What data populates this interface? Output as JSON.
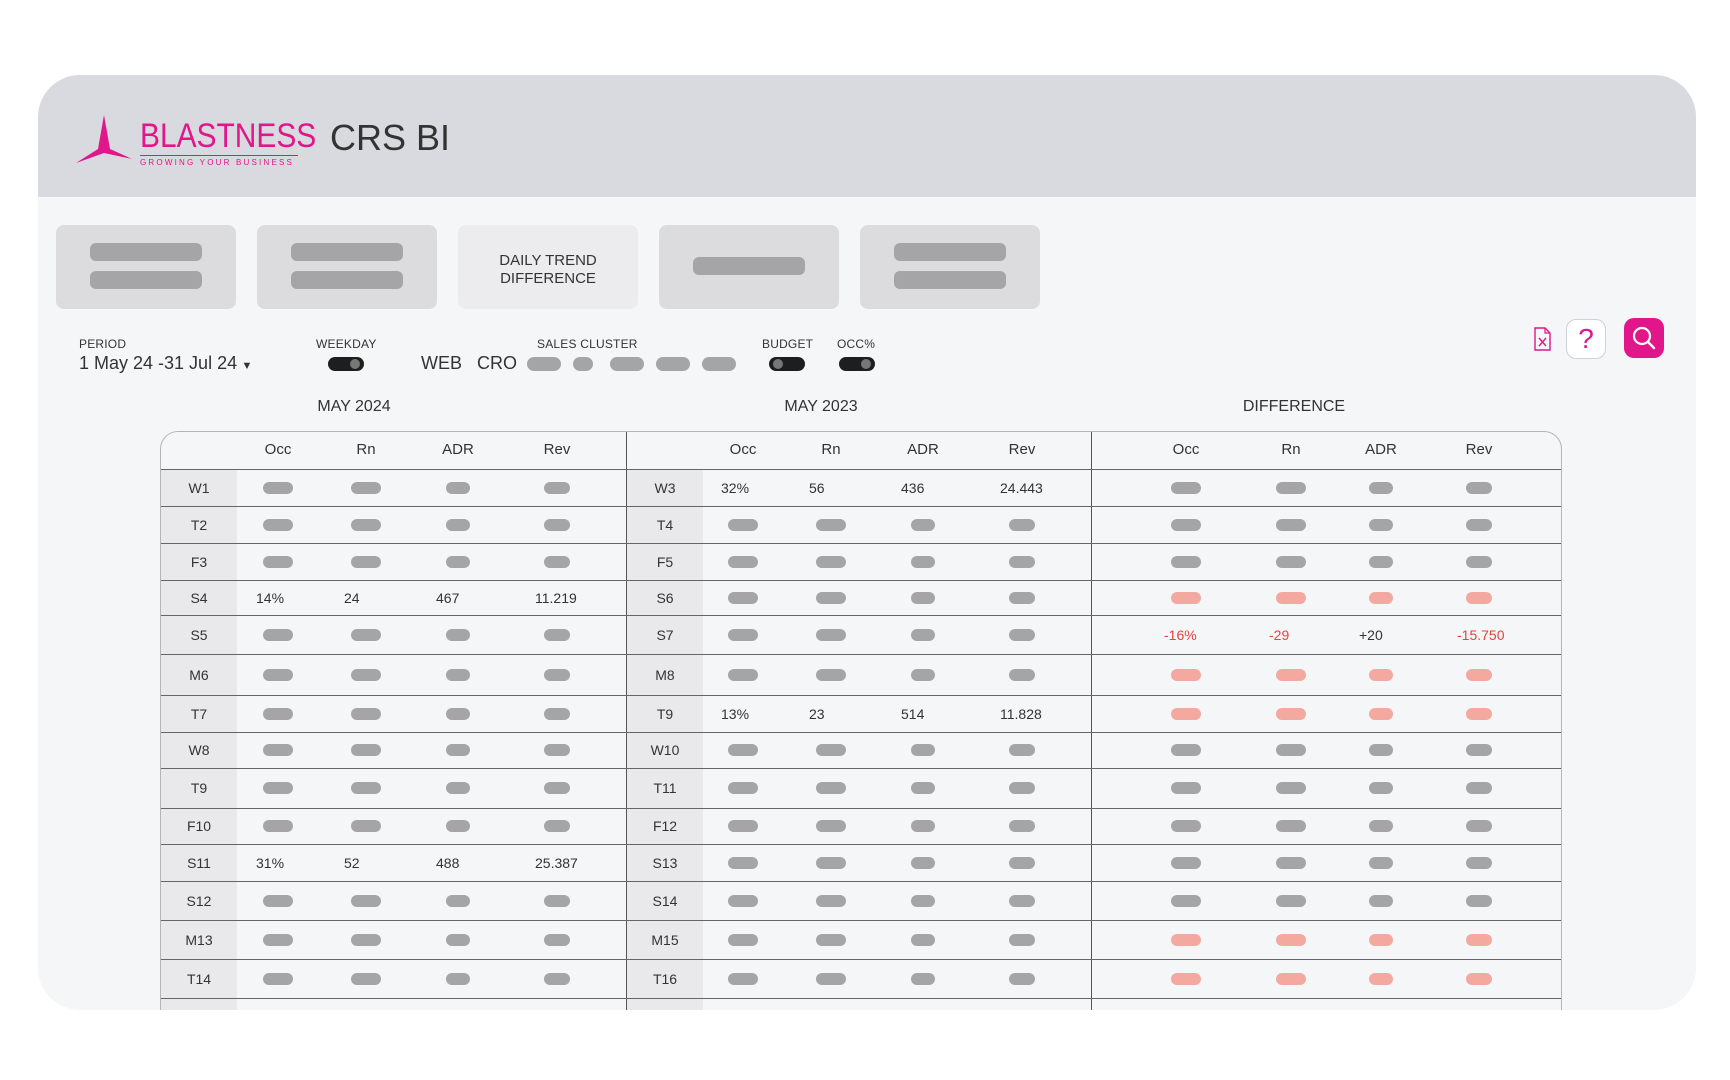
{
  "header": {
    "brand": "BLASTNESS",
    "tagline": "GROWING YOUR BUSINESS",
    "title": "CRS BI",
    "brand_color": "#e0168a",
    "header_bg": "#d9dadf"
  },
  "cards": [
    {
      "label": "",
      "placeholder_lines": 2
    },
    {
      "label": "",
      "placeholder_lines": 2
    },
    {
      "label": "DAILY TREND DIFFERENCE",
      "label_line1": "DAILY TREND",
      "label_line2": "DIFFERENCE",
      "placeholder_lines": 0
    },
    {
      "label": "",
      "placeholder_lines": 1
    },
    {
      "label": "",
      "placeholder_lines": 2
    }
  ],
  "filters": {
    "period_label": "PERIOD",
    "period_value": "1 May 24 -31 Jul 24",
    "weekday_label": "WEEKDAY",
    "sales_cluster_label": "SALES CLUSTER",
    "channel_web": "WEB",
    "channel_cro": "CRO",
    "budget_label": "BUDGET",
    "occ_label": "OCC%"
  },
  "toolbar": {
    "help_glyph": "?",
    "icons": [
      "excel-export-icon",
      "help-icon",
      "search-icon"
    ]
  },
  "table": {
    "sections": [
      "MAY 2024",
      "MAY 2023",
      "DIFFERENCE"
    ],
    "columns": [
      "Occ",
      "Rn",
      "ADR",
      "Rev"
    ],
    "days_2024": [
      "W1",
      "T2",
      "F3",
      "S4",
      "S5",
      "M6",
      "T7",
      "W8",
      "T9",
      "F10",
      "S11",
      "S12",
      "M13",
      "T14"
    ],
    "days_2023": [
      "W3",
      "T4",
      "F5",
      "S6",
      "S7",
      "M8",
      "T9",
      "W10",
      "T11",
      "F12",
      "S13",
      "S14",
      "M15",
      "T16"
    ],
    "values_2024": {
      "3": [
        "14%",
        "24",
        "467",
        "11.219"
      ],
      "10": [
        "31%",
        "52",
        "488",
        "25.387"
      ]
    },
    "values_2023": {
      "0": [
        "32%",
        "56",
        "436",
        "24.443"
      ],
      "6": [
        "13%",
        "23",
        "514",
        "11.828"
      ]
    },
    "values_diff": {
      "4": [
        "-16%",
        "-29",
        "+20",
        "-15.750"
      ]
    },
    "diff_negative_rows": [
      3,
      5,
      6,
      12,
      13
    ],
    "diff_value_negative": [
      true,
      true,
      false,
      true
    ],
    "placeholder_color": "#a5a5a8",
    "negative_placeholder_color": "#f3a9a0",
    "negative_text_color": "#e9433a"
  }
}
